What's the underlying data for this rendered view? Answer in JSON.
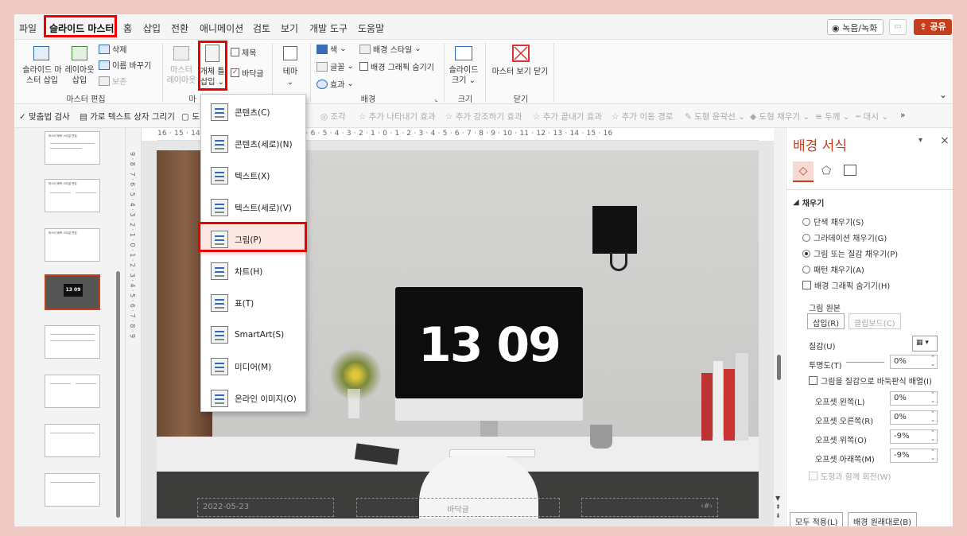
{
  "tabs": [
    "파일",
    "슬라이드 마스터",
    "홈",
    "삽입",
    "전환",
    "애니메이션",
    "검토",
    "보기",
    "개발 도구",
    "도움말"
  ],
  "active_tab": "슬라이드 마스터",
  "header_buttons": {
    "record": "녹음/녹화",
    "share": "공유"
  },
  "ribbon": {
    "insert_master_line1": "슬라이드 마",
    "insert_master_line2": "스터 삽입",
    "insert_layout_line1": "레이아웃",
    "insert_layout_line2": "삽입",
    "delete": "삭제",
    "rename": "이름 바꾸기",
    "preserve": "보존",
    "master_layout_line1": "마스터",
    "master_layout_line2": "레이아웃",
    "insert_placeholder_line1": "개체 틀",
    "insert_placeholder_line2": "삽입",
    "title_check": "제목",
    "footer_check": "바닥글",
    "theme": "테마",
    "colors": "색",
    "fonts": "글꼴",
    "effects": "효과",
    "bg_styles": "배경 스타일",
    "hide_bg": "배경 그래픽 숨기기",
    "slide_size_line1": "슬라이드",
    "slide_size_line2": "크기",
    "close_master": "마스터 보기 닫기",
    "groups": {
      "master_edit": "마스터 편집",
      "master_layout": "마",
      "background": "배경",
      "size": "크기",
      "close": "닫기"
    }
  },
  "qat": [
    "맞춤법 검사",
    "가로 텍스트 상자 그리기",
    "도",
    "조각",
    "추가 나타내기 효과",
    "추가 강조하기 효과",
    "추가 끝내기 효과",
    "추가 이동 경로",
    "도형 윤곽선",
    "도형 채우기",
    "두께",
    "대시"
  ],
  "ruler_text": "16 · 15 · 14 · 13 · 12 · 11 · 10 · 9 · 8 · 7 · 6 · 5 · 4 · 3 · 2 · 1 · 0 · 1 · 2 · 3 · 4 · 5 · 6 · 7 · 8 · 9 · 10 · 11 · 12 · 13 · 14 · 15 · 16",
  "vruler_text": "9 · 8 · 7 · 6 · 5 · 4 · 3 · 2 · 1 · 0 · 1 · 2 · 3 · 4 · 5 · 6 · 7 · 8 · 9",
  "thumbnail_title": "마스터 제목 스타일 편집",
  "slide": {
    "clock": "13 09",
    "date": "2022-05-23",
    "footer": "바닥글",
    "page": "‹#›"
  },
  "dropdown": {
    "items": [
      "콘텐츠(C)",
      "콘텐츠(세로)(N)",
      "텍스트(X)",
      "텍스트(세로)(V)",
      "그림(P)",
      "차트(H)",
      "표(T)",
      "SmartArt(S)",
      "미디어(M)",
      "온라인 이미지(O)"
    ],
    "highlighted": "그림(P)"
  },
  "pane": {
    "title": "배경 서식",
    "section": "채우기",
    "fill_options": [
      "단색 채우기(S)",
      "그라데이션 채우기(G)",
      "그림 또는 질감 채우기(P)",
      "패턴 채우기(A)"
    ],
    "selected_fill": "그림 또는 질감 채우기(P)",
    "hide_bg": "배경 그래픽 숨기기(H)",
    "picture_source": "그림 원본",
    "insert_btn": "삽입(R)",
    "clipboard_btn": "클립보드(C)",
    "texture": "질감(U)",
    "transparency": "투명도(T)",
    "transparency_value": "0%",
    "tile": "그림을 질감으로 바둑판식 배열(I)",
    "offset_left": "오프셋 왼쪽(L)",
    "offset_left_value": "0%",
    "offset_right": "오프셋 오른쪽(R)",
    "offset_right_value": "0%",
    "offset_top": "오프셋 위쪽(O)",
    "offset_top_value": "-9%",
    "offset_bottom": "오프셋 아래쪽(M)",
    "offset_bottom_value": "-9%",
    "rotate": "도형과 함께 회전(W)",
    "apply_all": "모두 적용(L)",
    "reset": "배경 원래대로(B)"
  },
  "colors": {
    "accent": "#c43e1c",
    "highlight_box": "#e00000"
  }
}
